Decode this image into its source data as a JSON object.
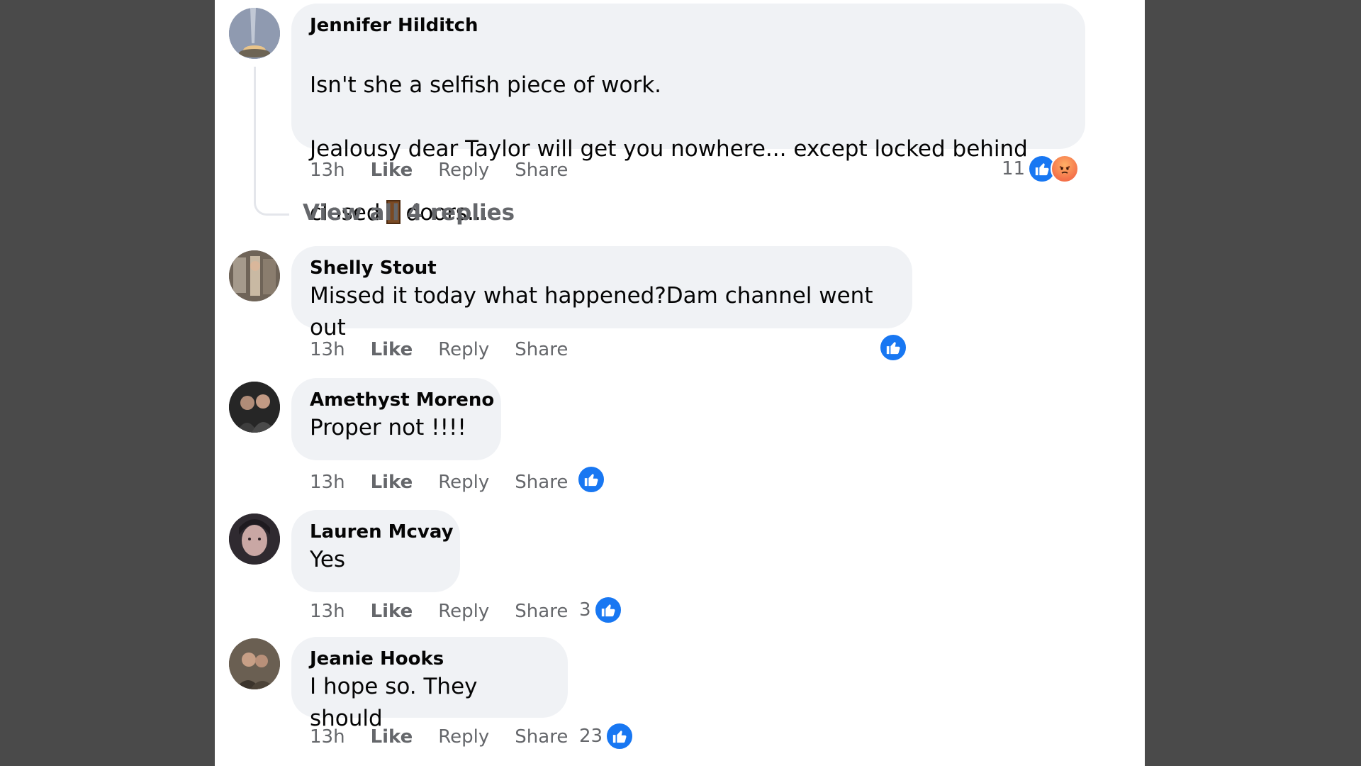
{
  "comments": [
    {
      "author": "Jennifer Hilditch",
      "line1": "Isn't she a selfish piece of work.",
      "line2": "Jealousy dear Taylor will get you nowhere... except locked behind",
      "line3_before": "closed",
      "line3_emoji": "door-emoji",
      "line3_after": "doors...",
      "time": "13h",
      "reaction_count": "11",
      "reactions": [
        "like-icon",
        "angry-icon"
      ]
    },
    {
      "author": "Shelly Stout",
      "text": "Missed it today what happened?Dam channel went out",
      "time": "13h",
      "reactions": [
        "like-icon"
      ]
    },
    {
      "author": "Amethyst Moreno",
      "text": "Proper not !!!!",
      "time": "13h",
      "reactions": [
        "like-icon"
      ]
    },
    {
      "author": "Lauren Mcvay",
      "text": "Yes",
      "time": "13h",
      "reaction_count": "3",
      "reactions": [
        "like-icon"
      ]
    },
    {
      "author": "Jeanie Hooks",
      "text": "I hope so. They should",
      "time": "13h",
      "reaction_count": "23",
      "reactions": [
        "like-icon"
      ]
    }
  ],
  "actions": {
    "like": "Like",
    "reply": "Reply",
    "share": "Share"
  },
  "view_replies": "View all 4 replies",
  "colors": {
    "brand_blue": "#1877f2",
    "bubble": "#f0f2f5",
    "muted": "#65676b",
    "angry": "#f4714a"
  }
}
